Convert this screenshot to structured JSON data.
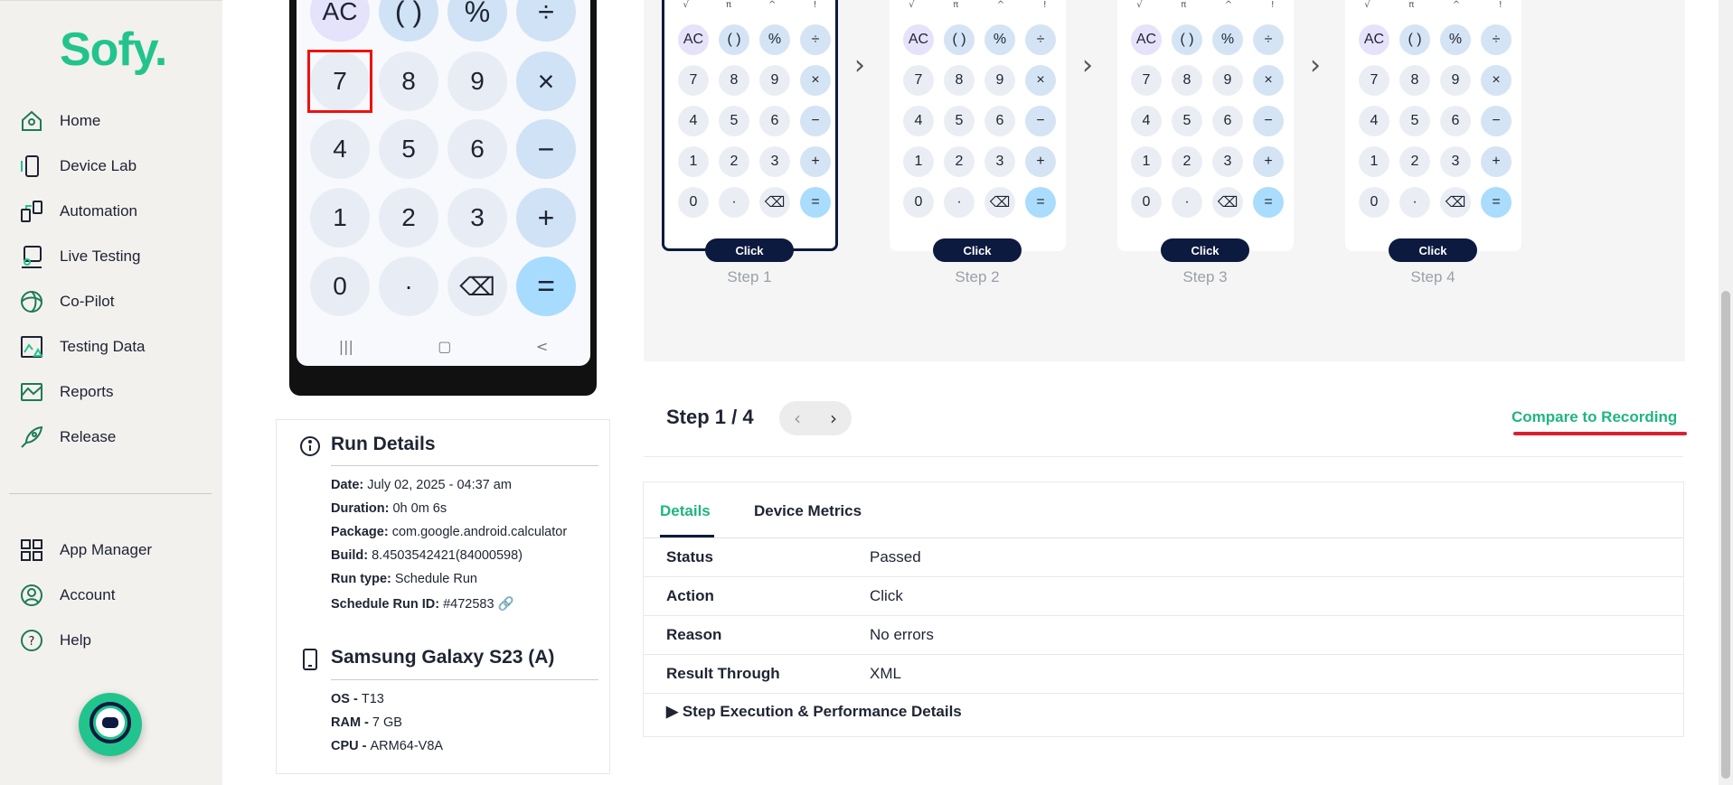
{
  "brand": {
    "logo": "Sofy."
  },
  "sidebar": {
    "items": [
      {
        "label": "Home",
        "icon": "home-icon"
      },
      {
        "label": "Device Lab",
        "icon": "device-icon"
      },
      {
        "label": "Automation",
        "icon": "automation-icon"
      },
      {
        "label": "Live Testing",
        "icon": "live-testing-icon"
      },
      {
        "label": "Co-Pilot",
        "icon": "copilot-icon"
      },
      {
        "label": "Testing Data",
        "icon": "testing-data-icon"
      },
      {
        "label": "Reports",
        "icon": "reports-icon"
      },
      {
        "label": "Release",
        "icon": "rocket-icon"
      }
    ],
    "bottom_items": [
      {
        "label": "App Manager",
        "icon": "grid-icon"
      },
      {
        "label": "Account",
        "icon": "user-icon"
      },
      {
        "label": "Help",
        "icon": "help-icon"
      }
    ]
  },
  "calculator": {
    "top_row": [
      "AC",
      "( )",
      "%",
      "÷"
    ],
    "rows": [
      [
        "7",
        "8",
        "9",
        "×"
      ],
      [
        "4",
        "5",
        "6",
        "−"
      ],
      [
        "1",
        "2",
        "3",
        "+"
      ],
      [
        "0",
        "·",
        "⌫",
        "="
      ]
    ],
    "mini_top": [
      "√",
      "π",
      "^",
      "!"
    ]
  },
  "steps": [
    {
      "label": "Step 1",
      "action": "Click"
    },
    {
      "label": "Step 2",
      "action": "Click"
    },
    {
      "label": "Step 3",
      "action": "Click"
    },
    {
      "label": "Step 4",
      "action": "Click"
    }
  ],
  "run_details": {
    "title": "Run Details",
    "date_k": "Date:",
    "date_v": "July 02, 2025 - 04:37 am",
    "duration_k": "Duration:",
    "duration_v": "0h 0m 6s",
    "package_k": "Package:",
    "package_v": "com.google.android.calculator",
    "build_k": "Build:",
    "build_v": "8.4503542421(84000598)",
    "runtype_k": "Run type:",
    "runtype_v": "Schedule Run",
    "schedule_k": "Schedule Run ID:",
    "schedule_v": "#472583"
  },
  "device": {
    "title": "Samsung Galaxy S23 (A)",
    "os_k": "OS - ",
    "os_v": "T13",
    "ram_k": "RAM - ",
    "ram_v": "7 GB",
    "cpu_k": "CPU - ",
    "cpu_v": "ARM64-V8A"
  },
  "step_nav": {
    "title": "Step 1 / 4",
    "compare": "Compare to Recording"
  },
  "details": {
    "tabs": [
      "Details",
      "Device Metrics"
    ],
    "rows": [
      {
        "k": "Status",
        "v": "Passed"
      },
      {
        "k": "Action",
        "v": "Click"
      },
      {
        "k": "Reason",
        "v": "No errors"
      },
      {
        "k": "Result Through",
        "v": "XML"
      }
    ],
    "expand": "Step Execution & Performance Details"
  }
}
